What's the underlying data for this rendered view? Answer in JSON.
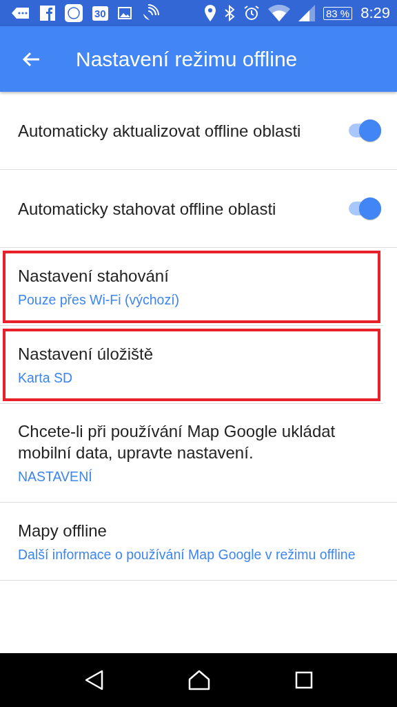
{
  "status_bar": {
    "calendar_day": "30",
    "battery": "83 %",
    "time": "8:29"
  },
  "app_bar": {
    "title": "Nastavení režimu offline"
  },
  "settings": [
    {
      "kind": "toggle",
      "title": "Automaticky aktualizovat offline oblasti",
      "on": true,
      "highlighted": false
    },
    {
      "kind": "toggle",
      "title": "Automaticky stahovat offline oblasti",
      "on": true,
      "highlighted": false
    },
    {
      "kind": "option",
      "title": "Nastavení stahování",
      "value": "Pouze přes Wi-Fi (výchozí)",
      "highlighted": true
    },
    {
      "kind": "option",
      "title": "Nastavení úložiště",
      "value": "Karta SD",
      "highlighted": true
    },
    {
      "kind": "link",
      "title": "Chcete-li při používání Map Google ukládat mobilní data, upravte nastavení.",
      "value": "NASTAVENÍ",
      "highlighted": false
    },
    {
      "kind": "option",
      "title": "Mapy offline",
      "value": "Další informace o používání Map Google v režimu offline",
      "highlighted": false
    }
  ]
}
